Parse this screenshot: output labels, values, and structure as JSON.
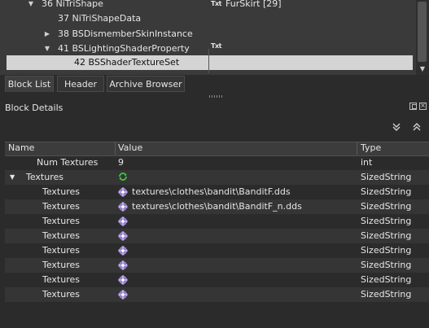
{
  "block_list": {
    "rows": [
      {
        "label": "36 NiTriShape",
        "arrow": "expanded",
        "txt_icon": "Txt",
        "extra": "FurSkirt [29]"
      },
      {
        "label": "37 NiTriShapeData",
        "arrow": "none",
        "txt_icon": "",
        "extra": ""
      },
      {
        "label": "38 BSDismemberSkinInstance",
        "arrow": "collapsed",
        "txt_icon": "",
        "extra": ""
      },
      {
        "label": "41 BSLightingShaderProperty",
        "arrow": "expanded",
        "txt_icon": "Txt",
        "extra": ""
      },
      {
        "label": "42 BSShaderTextureSet",
        "arrow": "none",
        "txt_icon": "",
        "extra": "",
        "selected": true
      }
    ],
    "scrollbar_icons": {
      "down": "scroll-down-arrow-icon"
    }
  },
  "tabs": [
    {
      "label": "Block List",
      "active": true
    },
    {
      "label": "Header",
      "active": false
    },
    {
      "label": "Archive Browser",
      "active": false
    }
  ],
  "block_details": {
    "title": "Block Details",
    "columns": [
      "Name",
      "Value",
      "Type"
    ],
    "rows": [
      {
        "name": "Num Textures",
        "value": "9",
        "type": "int",
        "icon": "",
        "indent": 1
      },
      {
        "name": "Textures",
        "value": "",
        "type": "SizedString",
        "icon": "refresh-icon",
        "indent": 0,
        "arrow": "expanded"
      },
      {
        "name": "Textures",
        "value": "textures\\clothes\\bandit\\BanditF.dds",
        "type": "SizedString",
        "icon": "texture-flower-icon",
        "indent": 2
      },
      {
        "name": "Textures",
        "value": "textures\\clothes\\bandit\\BanditF_n.dds",
        "type": "SizedString",
        "icon": "texture-flower-icon",
        "indent": 2
      },
      {
        "name": "Textures",
        "value": "",
        "type": "SizedString",
        "icon": "texture-flower-icon",
        "indent": 2
      },
      {
        "name": "Textures",
        "value": "",
        "type": "SizedString",
        "icon": "texture-flower-icon",
        "indent": 2
      },
      {
        "name": "Textures",
        "value": "",
        "type": "SizedString",
        "icon": "texture-flower-icon",
        "indent": 2
      },
      {
        "name": "Textures",
        "value": "",
        "type": "SizedString",
        "icon": "texture-flower-icon",
        "indent": 2
      },
      {
        "name": "Textures",
        "value": "",
        "type": "SizedString",
        "icon": "texture-flower-icon",
        "indent": 2
      },
      {
        "name": "Textures",
        "value": "",
        "type": "SizedString",
        "icon": "texture-flower-icon",
        "indent": 2
      }
    ]
  },
  "colors": {
    "background": "#2b2b2b",
    "tree_background": "#3a3a3a",
    "selection": "#d4d4d4",
    "text": "#e6e6e6",
    "flower_icon": "#b9a6e6"
  }
}
